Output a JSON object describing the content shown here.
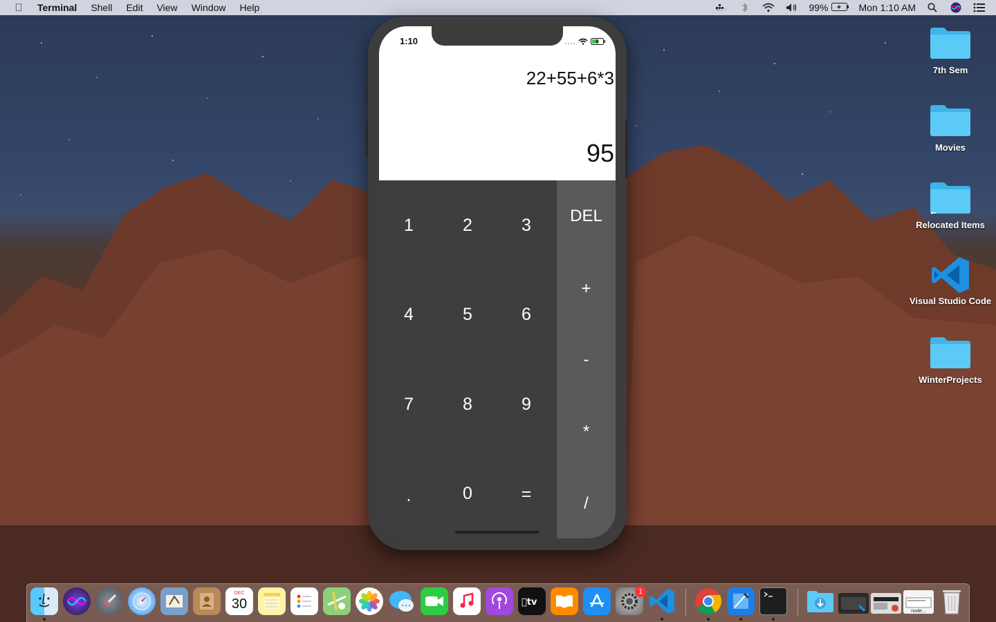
{
  "menubar": {
    "app_name": "Terminal",
    "menus": [
      "Shell",
      "Edit",
      "View",
      "Window",
      "Help"
    ],
    "battery": "99%",
    "clock": "Mon 1:10 AM"
  },
  "desktop": {
    "icons": [
      {
        "label": "7th Sem",
        "icon": "folder-icon"
      },
      {
        "label": "Movies",
        "icon": "folder-icon"
      },
      {
        "label": "Relocated Items",
        "icon": "folder-alias-icon"
      },
      {
        "label": "Visual Studio Code",
        "icon": "vscode-icon"
      },
      {
        "label": "WinterProjects",
        "icon": "folder-icon"
      }
    ]
  },
  "simulator": {
    "status_time": "1:10",
    "expression": "22+55+6*3",
    "result": "95",
    "keys": [
      "1",
      "2",
      "3",
      "4",
      "5",
      "6",
      "7",
      "8",
      "9",
      ".",
      "0",
      "="
    ],
    "operators": [
      "DEL",
      "+",
      "-",
      "*",
      "/"
    ]
  },
  "dock": {
    "calendar_month": "DEC",
    "calendar_day": "30",
    "settings_badge": "1",
    "node_label": "node..."
  },
  "colors": {
    "display_bg": "#ffffff",
    "keypad_bg": "#3e3e3e",
    "operator_bg": "#5a5a5a",
    "phone_frame": "#3d3d3d",
    "folder_blue": "#4cc3f5"
  }
}
